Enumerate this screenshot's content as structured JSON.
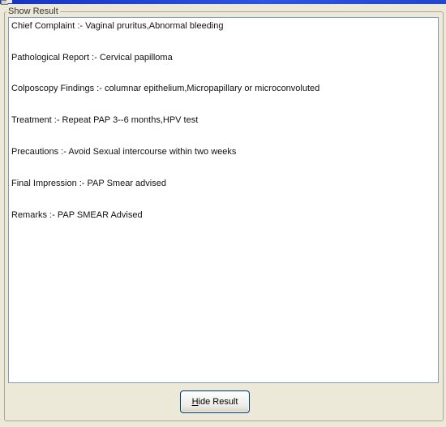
{
  "window": {
    "title_icon": "app-icon"
  },
  "group": {
    "caption": "Show Result"
  },
  "results": [
    {
      "text": "Chief Complaint :- Vaginal pruritus,Abnormal bleeding"
    },
    {
      "text": "Pathological Report :- Cervical papilloma"
    },
    {
      "text": "Colposcopy Findings :- columnar epithelium,Micropapillary or microconvoluted"
    },
    {
      "text": "Treatment :- Repeat PAP 3--6 months,HPV test"
    },
    {
      "text": "Precautions :- Avoid Sexual intercourse within two weeks"
    },
    {
      "text": "Final Impression :- PAP Smear advised"
    },
    {
      "text": "Remarks :- PAP SMEAR Advised"
    }
  ],
  "buttons": {
    "hide_result": {
      "mnemonic": "H",
      "rest": "ide Result"
    }
  }
}
